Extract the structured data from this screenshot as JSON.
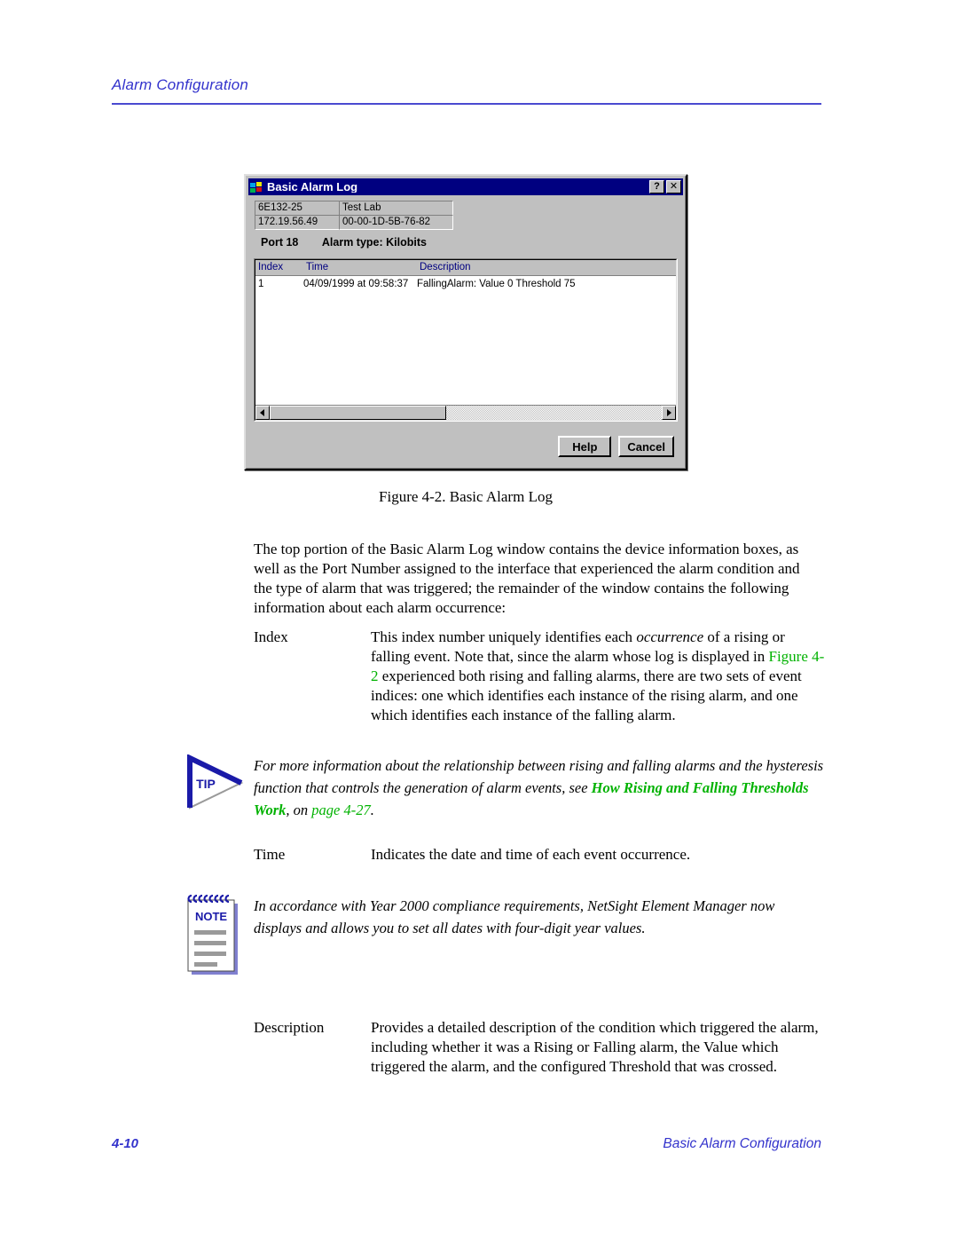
{
  "page": {
    "header_title": "Alarm Configuration",
    "footer_page_number": "4-10",
    "footer_section": "Basic Alarm Configuration",
    "accent_blue": "#3333cc",
    "link_green": "#00b200"
  },
  "dialog": {
    "title": "Basic Alarm Log",
    "icon": "windows-logo-icon",
    "help_button_label": "?",
    "close_button_label": "✕",
    "device_info": {
      "device_name": "6E132-25",
      "location": "Test Lab",
      "ip_address": "172.19.56.49",
      "mac_address": "00-00-1D-5B-76-82"
    },
    "port_label": "Port 18",
    "alarm_type_label": "Alarm type: Kilobits",
    "columns": [
      "Index",
      "Time",
      "Description"
    ],
    "rows": [
      {
        "index": "1",
        "time": "04/09/1999 at 09:58:37",
        "description": "FallingAlarm: Value 0  Threshold 75"
      }
    ],
    "scrollbar": {
      "left_arrow": "scroll-left-arrow-icon",
      "right_arrow": "scroll-right-arrow-icon",
      "thumb_fraction": "45%"
    },
    "buttons": {
      "help": "Help",
      "cancel": "Cancel"
    }
  },
  "figure": {
    "caption": "Figure 4-2.  Basic Alarm Log"
  },
  "content": {
    "intro_paragraph": "The top portion of the Basic Alarm Log window contains the device information boxes, as well as the Port Number assigned to the interface that experienced the alarm condition and the type of alarm that was triggered; the remainder of the window contains the following information about each alarm occurrence:",
    "definitions": [
      {
        "term": "Index",
        "text_part1": "This index number uniquely identifies each ",
        "italic1": "occurrence",
        "text_part2": " of a rising or falling event. Note that, since the alarm whose log is displayed in ",
        "link": "Figure 4-2",
        "text_part3": " experienced both rising and falling alarms, there are two sets of event indices: one which identifies each instance of the rising alarm, and one which identifies each instance of the falling alarm."
      },
      {
        "term": "Time",
        "text": "Indicates the date and time of each event occurrence."
      },
      {
        "term": "Description",
        "text": "Provides a detailed description of the condition which triggered the alarm, including whether it was a Rising or Falling alarm, the Value which triggered the alarm, and the configured Threshold that was crossed."
      }
    ]
  },
  "tip": {
    "label": "TIP",
    "text_part1": "For more information about the relationship between rising and falling alarms and the hysteresis function that controls the generation of alarm events, see ",
    "link_title": "How Rising and Falling Thresholds Work",
    "text_part2": ", on ",
    "link_page": "page 4-27",
    "text_part3": "."
  },
  "note": {
    "label": "NOTE",
    "text": "In accordance with Year 2000 compliance requirements, NetSight Element Manager now displays and allows you to set all dates with four-digit year values."
  }
}
